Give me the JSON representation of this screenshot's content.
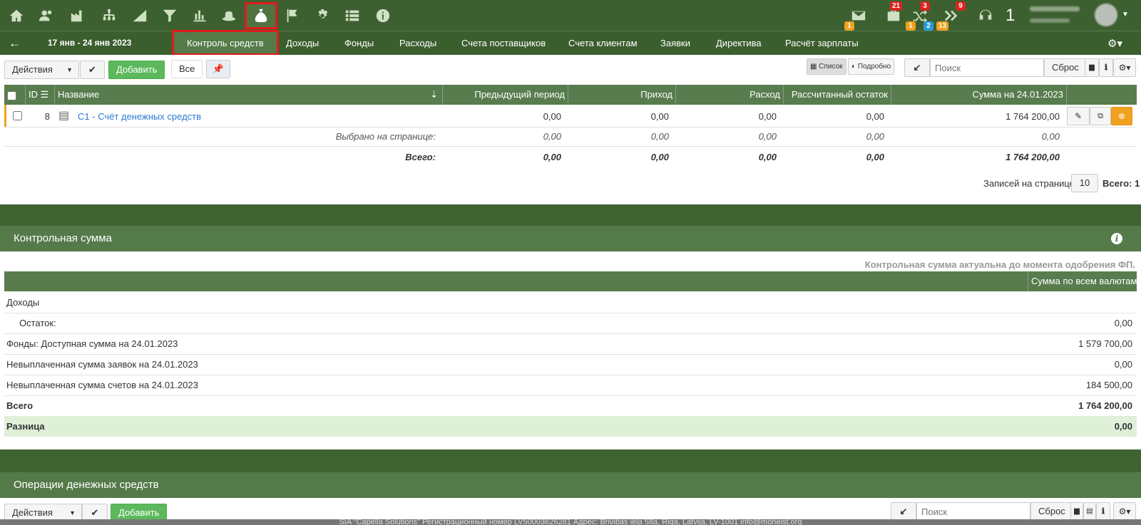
{
  "topbar": {
    "badges": {
      "mail": "1",
      "briefcase_top": "21",
      "briefcase_bottom": "1",
      "shuffle_top": "3",
      "shuffle_bottom": "2",
      "forward_top": "9",
      "forward_bottom": "13"
    },
    "user_number": "1"
  },
  "nav": {
    "date_range": "17 янв - 24 янв 2023",
    "tabs": [
      "Контроль средств",
      "Доходы",
      "Фонды",
      "Расходы",
      "Счета поставщиков",
      "Счета клиентам",
      "Заявки",
      "Директива",
      "Расчёт зарплаты"
    ]
  },
  "toolbar": {
    "actions": "Действия",
    "add": "Добавить",
    "all": "Все",
    "view_list": "Список",
    "view_detail": "Подробно",
    "search_placeholder": "Поиск",
    "reset": "Сброс"
  },
  "funds_table": {
    "headers": {
      "id": "ID",
      "name": "Название",
      "prev": "Предыдущий период",
      "income": "Приход",
      "expense": "Расход",
      "calc": "Рассчитанный остаток",
      "sum": "Сумма на 24.01.2023"
    },
    "row": {
      "id": "8",
      "name": "C1 - Счёт денежных средств",
      "prev": "0,00",
      "income": "0,00",
      "expense": "0,00",
      "calc": "0,00",
      "sum": "1 764 200,00"
    },
    "selected": {
      "label": "Выбрано на странице:",
      "prev": "0,00",
      "income": "0,00",
      "expense": "0,00",
      "calc": "0,00",
      "sum": "0,00"
    },
    "total": {
      "label": "Всего:",
      "prev": "0,00",
      "income": "0,00",
      "expense": "0,00",
      "calc": "0,00",
      "sum": "1 764 200,00"
    },
    "per_page_label": "Записей на странице",
    "per_page": "10",
    "total_count": "Всего: 1"
  },
  "control_sum": {
    "title": "Контрольная сумма",
    "note": "Контрольная сумма актуальна до момента одобрения ФП.",
    "column": "Сумма по всем валютам",
    "rows": [
      {
        "label": "Доходы",
        "value": ""
      },
      {
        "label": "Остаток:",
        "value": "0,00"
      },
      {
        "label": "Фонды: Доступная сумма на 24.01.2023",
        "value": "1 579 700,00"
      },
      {
        "label": "Невыплаченная сумма заявок на 24.01.2023",
        "value": "0,00"
      },
      {
        "label": "Невыплаченная сумма счетов на 24.01.2023",
        "value": "184 500,00"
      },
      {
        "label": "Всего",
        "value": "1 764 200,00"
      },
      {
        "label": "Разница",
        "value": "0,00"
      }
    ]
  },
  "operations": {
    "title": "Операции денежных средств",
    "actions": "Действия",
    "add": "Добавить",
    "search_placeholder": "Поиск",
    "reset": "Сброс"
  },
  "footer": {
    "text": "SIA \"Capella Solutions\" Регистрационный номер LV50003626281 Адрес: Brivibas iela 58a, Riga, Latvija, LV-1001 info@moneist.org"
  }
}
